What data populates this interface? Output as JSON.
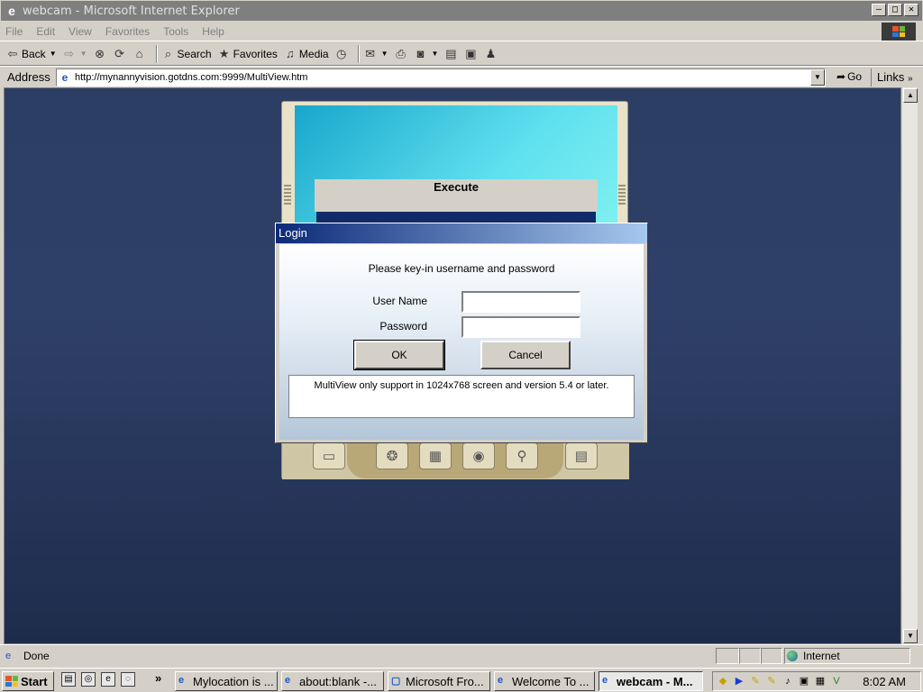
{
  "window": {
    "title": "webcam - Microsoft Internet Explorer",
    "controls": [
      "–",
      "□",
      "✕"
    ]
  },
  "menu": {
    "items": [
      "File",
      "Edit",
      "View",
      "Favorites",
      "Tools",
      "Help"
    ]
  },
  "toolbar": {
    "back_label": "Back",
    "search_label": "Search",
    "favorites_label": "Favorites",
    "media_label": "Media"
  },
  "address": {
    "label": "Address",
    "url": "http://mynannyvision.gotdns.com:9999/MultiView.htm",
    "go_label": "Go",
    "links_label": "Links"
  },
  "viewer": {
    "execute_label": "Execute"
  },
  "login": {
    "title": "Login",
    "prompt": "Please key-in username and password",
    "username_label": "User Name",
    "username_value": "",
    "password_label": "Password",
    "password_value": "",
    "ok_label": "OK",
    "cancel_label": "Cancel",
    "note": "MultiView only support in 1024x768 screen and version 5.4 or later."
  },
  "status": {
    "text": "Done",
    "zone": "Internet"
  },
  "taskbar": {
    "start_label": "Start",
    "tasks": [
      {
        "label": "Mylocation is ..."
      },
      {
        "label": "about:blank -..."
      },
      {
        "label": "Microsoft Fro..."
      },
      {
        "label": "Welcome To ..."
      },
      {
        "label": "webcam - M...",
        "active": true
      }
    ],
    "clock": "8:02 AM"
  },
  "colors": {
    "titlebar_inactive": "#7f7f7f",
    "dialog_title_start": "#0c2a78",
    "page_background": "#2c3e64"
  }
}
